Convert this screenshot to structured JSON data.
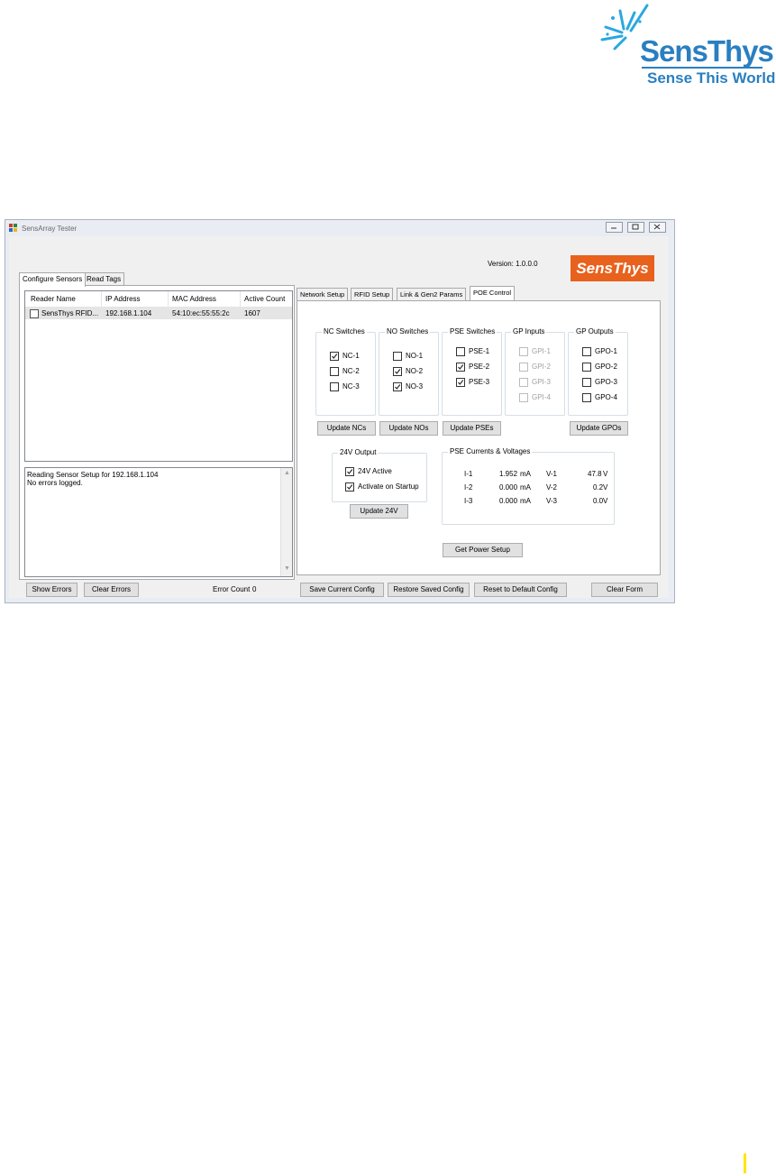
{
  "logo": {
    "name": "SensThys",
    "tagline": "Sense This World",
    "brand_color": "#2a7fc0"
  },
  "window": {
    "title": "SensArray Tester",
    "version": "Version: 1.0.0.0",
    "brand_box": {
      "text": "SensThys",
      "color": "#e8611d"
    }
  },
  "left_tabs": [
    "Configure Sensors",
    "Read Tags"
  ],
  "reader_list": {
    "columns": [
      "Reader Name",
      "IP Address",
      "MAC Address",
      "Active Count"
    ],
    "rows": [
      {
        "checked": false,
        "name": "SensThys RFID...",
        "ip": "192.168.1.104",
        "mac": "54:10:ec:55:55:2c",
        "count": "1607"
      }
    ]
  },
  "log": {
    "lines": [
      "Reading Sensor Setup for 192.168.1.104",
      "No errors logged."
    ]
  },
  "bottom_left": {
    "show_errors": "Show Errors",
    "clear_errors": "Clear Errors",
    "error_count_label": "Error Count",
    "error_count": "0"
  },
  "right_tabs": [
    "Network Setup",
    "RFID Setup",
    "Link & Gen2 Params",
    "POE Control"
  ],
  "poe": {
    "nc": {
      "title": "NC Switches",
      "items": [
        {
          "label": "NC-1",
          "checked": true
        },
        {
          "label": "NC-2",
          "checked": false
        },
        {
          "label": "NC-3",
          "checked": false
        }
      ],
      "button": "Update NCs"
    },
    "no": {
      "title": "NO Switches",
      "items": [
        {
          "label": "NO-1",
          "checked": false
        },
        {
          "label": "NO-2",
          "checked": true
        },
        {
          "label": "NO-3",
          "checked": true
        }
      ],
      "button": "Update NOs"
    },
    "pse": {
      "title": "PSE Switches",
      "items": [
        {
          "label": "PSE-1",
          "checked": false
        },
        {
          "label": "PSE-2",
          "checked": true
        },
        {
          "label": "PSE-3",
          "checked": true
        }
      ],
      "button": "Update PSEs"
    },
    "gpi": {
      "title": "GP Inputs",
      "items": [
        {
          "label": "GPI-1",
          "checked": false
        },
        {
          "label": "GPI-2",
          "checked": false
        },
        {
          "label": "GPI-3",
          "checked": false
        },
        {
          "label": "GPI-4",
          "checked": false
        }
      ]
    },
    "gpo": {
      "title": "GP Outputs",
      "items": [
        {
          "label": "GPO-1",
          "checked": false
        },
        {
          "label": "GPO-2",
          "checked": false
        },
        {
          "label": "GPO-3",
          "checked": false
        },
        {
          "label": "GPO-4",
          "checked": false
        }
      ],
      "button": "Update GPOs"
    },
    "v24": {
      "title": "24V Output",
      "items": [
        {
          "label": "24V Active",
          "checked": true
        },
        {
          "label": "Activate on Startup",
          "checked": true
        }
      ],
      "button": "Update 24V"
    },
    "pse_readings": {
      "title": "PSE Currents & Voltages",
      "rows": [
        {
          "i_label": "I-1",
          "i_value": "1.952",
          "i_unit": "mA",
          "v_label": "V-1",
          "v_value": "47.8",
          "v_unit": "V"
        },
        {
          "i_label": "I-2",
          "i_value": "0.000",
          "i_unit": "mA",
          "v_label": "V-2",
          "v_value": "0.2",
          "v_unit": "V"
        },
        {
          "i_label": "I-3",
          "i_value": "0.000",
          "i_unit": "mA",
          "v_label": "V-3",
          "v_value": "0.0",
          "v_unit": "V"
        }
      ]
    },
    "get_power_setup": "Get Power Setup"
  },
  "bottom_right": {
    "save": "Save Current Config",
    "restore": "Restore Saved Config",
    "reset": "Reset to Default Config",
    "clear": "Clear Form"
  }
}
